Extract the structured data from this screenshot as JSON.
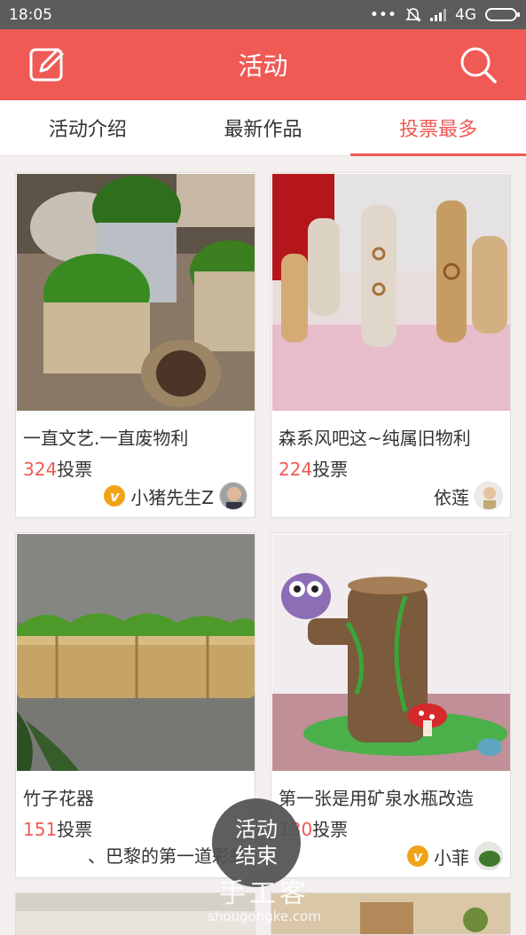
{
  "status_bar": {
    "time": "18:05",
    "network": "4G"
  },
  "app_bar": {
    "title": "活动"
  },
  "tabs": [
    {
      "label": "活动介绍",
      "active": false
    },
    {
      "label": "最新作品",
      "active": false
    },
    {
      "label": "投票最多",
      "active": true
    }
  ],
  "cards": [
    {
      "title": "一直文艺.一直废物利",
      "vote_count": "324",
      "vote_suffix": "投票",
      "author": "小猪先生Z",
      "vip": true
    },
    {
      "title": "森系风吧这~纯属旧物利",
      "vote_count": "224",
      "vote_suffix": "投票",
      "author": "依莲",
      "vip": false
    },
    {
      "title": "竹子花器",
      "vote_count": "151",
      "vote_suffix": "投票",
      "author": "、巴黎的第一道彩虹",
      "vip": false
    },
    {
      "title": "第一张是用矿泉水瓶改造",
      "vote_count": "130",
      "vote_suffix": "投票",
      "author": "小菲",
      "vip": true
    }
  ],
  "fab": {
    "line1": "活动",
    "line2": "结束"
  },
  "vip_badge": "v",
  "watermark": {
    "big": "手工客",
    "small": "shougongke.com"
  },
  "colors": {
    "accent": "#ef5a55",
    "vip": "#f0a319"
  }
}
